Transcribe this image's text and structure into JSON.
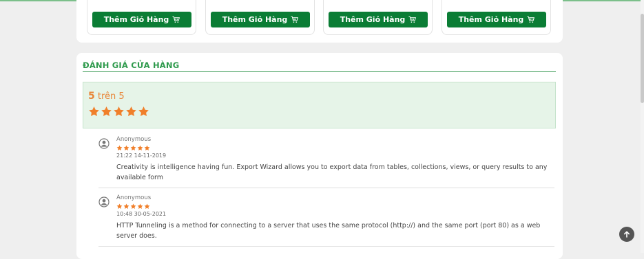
{
  "products": {
    "add_to_cart_label": "Thêm Giỏ Hàng",
    "cart_icon": "cart-icon",
    "button_color": "#0b7d35"
  },
  "reviews_section": {
    "title": "ĐÁNH GIÁ CỬA HÀNG",
    "accent_color": "#2e9a4c",
    "summary": {
      "score": "5",
      "out_of_text": "trên 5",
      "stars": 5,
      "star_color": "#f07f2a"
    },
    "items": [
      {
        "author": "Anonymous",
        "stars": 5,
        "time": "21:22 14-11-2019",
        "text": "Creativity is intelligence having fun. Export Wizard allows you to export data from tables, collections, views, or query results to any available form"
      },
      {
        "author": "Anonymous",
        "stars": 5,
        "time": "10:48 30-05-2021",
        "text": "HTTP Tunneling is a method for connecting to a server that uses the same protocol (http://) and the same port (port 80) as a web server does."
      }
    ]
  },
  "scroll_top_icon": "arrow-up-icon"
}
